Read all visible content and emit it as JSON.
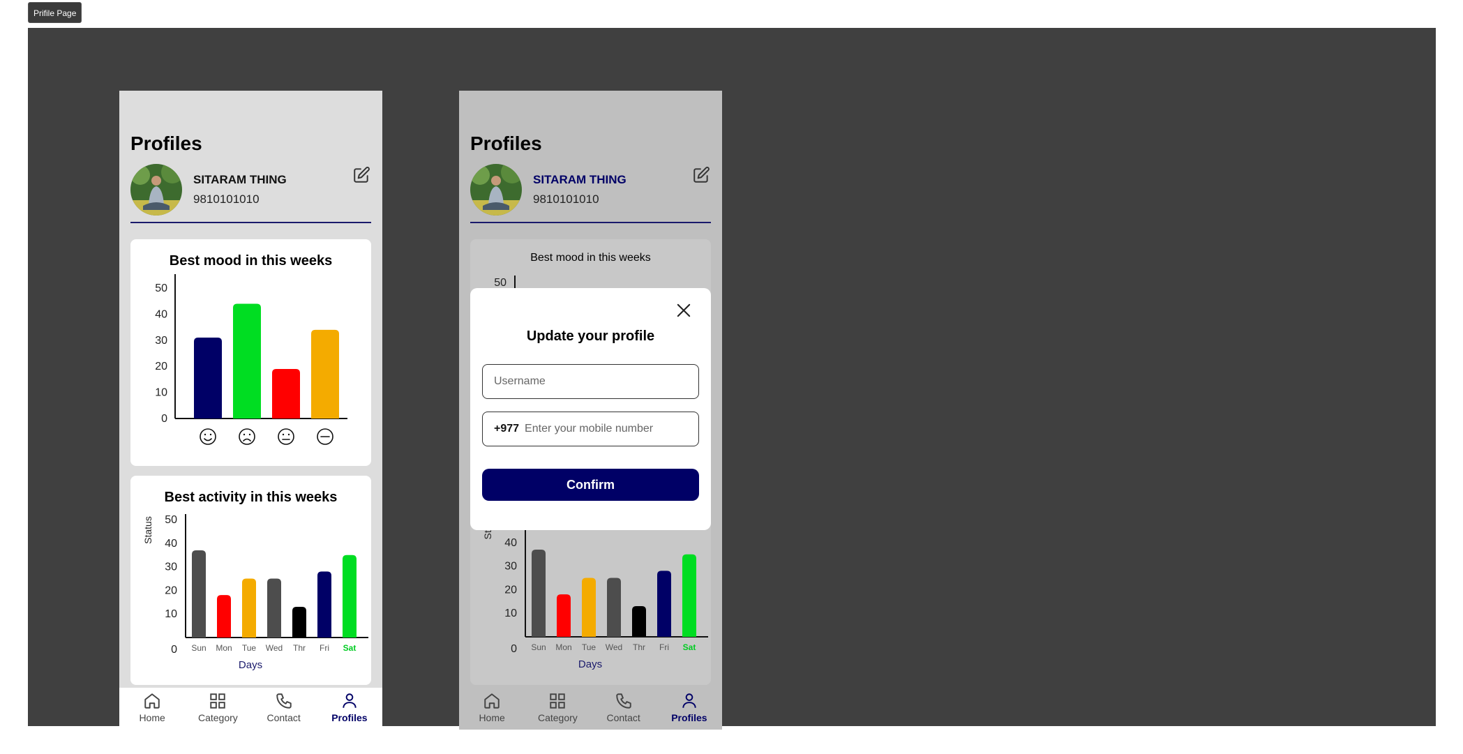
{
  "frame_label": "Prifile Page",
  "screens": [
    {
      "title": "Profiles",
      "user": {
        "name": "SITARAM THING",
        "phone": "9810101010"
      },
      "mood_card": {
        "title": "Best mood in this weeks"
      },
      "activity_card": {
        "title": "Best activity in this weeks"
      },
      "nav": [
        {
          "label": "Home",
          "icon": "home-icon"
        },
        {
          "label": "Category",
          "icon": "grid-icon"
        },
        {
          "label": "Contact",
          "icon": "phone-icon"
        },
        {
          "label": "Profiles",
          "icon": "user-icon",
          "active": true
        }
      ]
    },
    {
      "title": "Profiles",
      "user": {
        "name": "SITARAM THING",
        "phone": "9810101010"
      },
      "mood_card": {
        "title": "Best mood in this weeks"
      },
      "nav": [
        {
          "label": "Home",
          "icon": "home-icon"
        },
        {
          "label": "Category",
          "icon": "grid-icon"
        },
        {
          "label": "Contact",
          "icon": "phone-icon"
        },
        {
          "label": "Profiles",
          "icon": "user-icon",
          "active": true
        }
      ],
      "modal": {
        "title": "Update your profile",
        "username_placeholder": "Username",
        "phone_prefix": "+977",
        "phone_placeholder": "Enter your mobile number",
        "confirm_label": "Confirm"
      }
    }
  ],
  "colors": {
    "navy": "#000066",
    "green": "#00dd22",
    "red": "#ff0000",
    "amber": "#f4ab00",
    "gray": "#4d4d4d",
    "black": "#000000"
  },
  "chart_data": [
    {
      "type": "bar",
      "title": "Best mood in this weeks",
      "categories": [
        "happy-face-icon",
        "sad-face-icon",
        "neutral-face-icon",
        "minus-circle-icon"
      ],
      "values": [
        31,
        44,
        19,
        34
      ],
      "colors": [
        "#000066",
        "#00dd22",
        "#ff0000",
        "#f4ab00"
      ],
      "yticks": [
        "0",
        "10",
        "20",
        "30",
        "40",
        "50"
      ],
      "ylim": [
        0,
        50
      ]
    },
    {
      "type": "bar",
      "title": "Best activity in this weeks",
      "categories": [
        "Sun",
        "Mon",
        "Tue",
        "Wed",
        "Thr",
        "Fri",
        "Sat"
      ],
      "values": [
        37,
        18,
        25,
        25,
        13,
        28,
        35
      ],
      "colors": [
        "#4d4d4d",
        "#ff0000",
        "#f4ab00",
        "#4d4d4d",
        "#000000",
        "#000066",
        "#00dd22"
      ],
      "highlight": "Sat",
      "xlabel": "Days",
      "ylabel": "Status",
      "yticks": [
        "0",
        "10",
        "20",
        "30",
        "40",
        "50"
      ],
      "ylim": [
        0,
        50
      ]
    },
    {
      "type": "bar",
      "title": "Best mood in this weeks",
      "yticks": [
        "50"
      ],
      "ylim": [
        0,
        50
      ]
    },
    {
      "type": "bar",
      "categories": [
        "Sun",
        "Mon",
        "Tue",
        "Wed",
        "Thr",
        "Fri",
        "Sat"
      ],
      "values": [
        37,
        18,
        25,
        25,
        13,
        28,
        35
      ],
      "colors": [
        "#4d4d4d",
        "#ff0000",
        "#f4ab00",
        "#4d4d4d",
        "#000000",
        "#000066",
        "#00dd22"
      ],
      "highlight": "Sat",
      "xlabel": "Days",
      "ylabel": "Sta",
      "yticks": [
        "0",
        "10",
        "20",
        "30",
        "40"
      ],
      "ylim": [
        0,
        50
      ]
    }
  ]
}
